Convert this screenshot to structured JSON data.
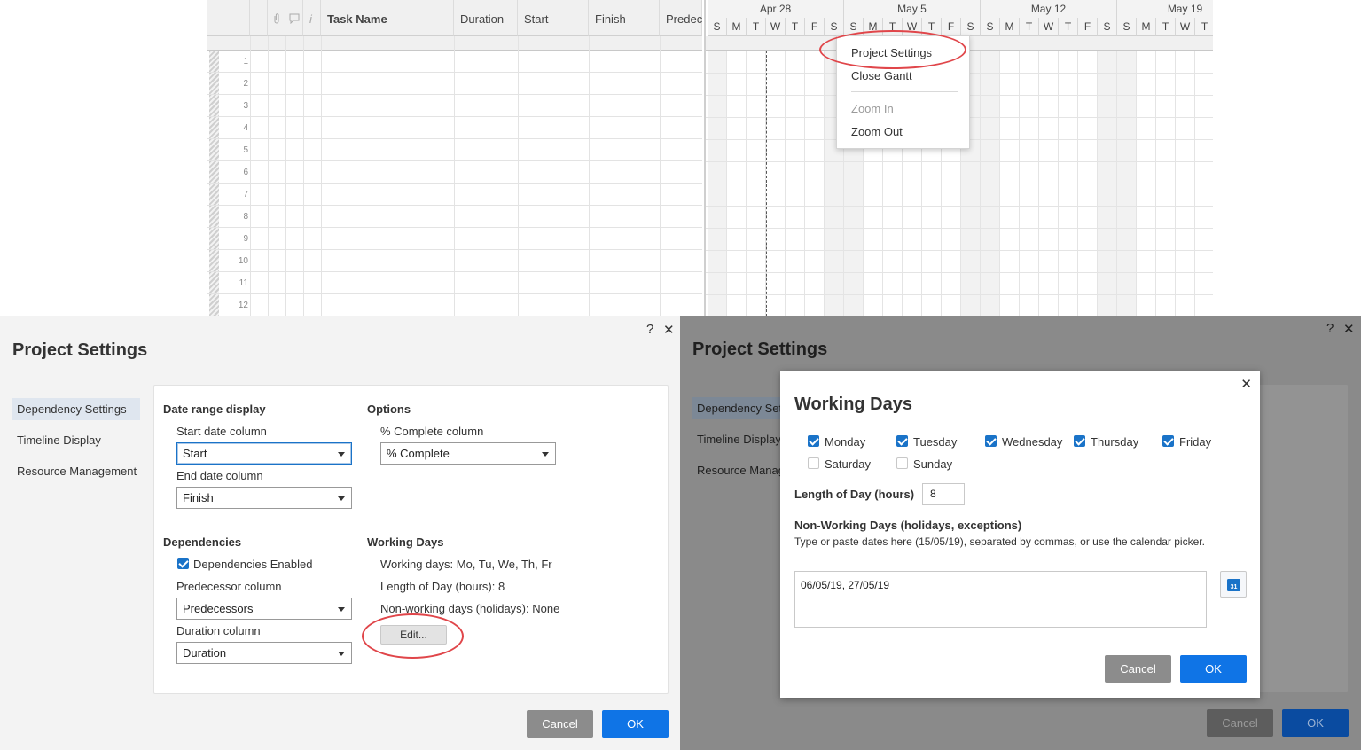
{
  "sheet": {
    "columns": [
      "Task Name",
      "Duration",
      "Start",
      "Finish",
      "Predec"
    ],
    "row_numbers": [
      "1",
      "2",
      "3",
      "4",
      "5",
      "6",
      "7",
      "8",
      "9",
      "10",
      "11",
      "12"
    ]
  },
  "gantt": {
    "weeks": [
      "Apr 28",
      "May 5",
      "May 12",
      "May 19"
    ],
    "days": [
      "S",
      "M",
      "T",
      "W",
      "T",
      "F",
      "S",
      "S",
      "M",
      "T",
      "W",
      "T",
      "F",
      "S",
      "S",
      "M",
      "T",
      "W",
      "T",
      "F",
      "S",
      "S",
      "M",
      "T",
      "W",
      "T"
    ]
  },
  "context_menu": {
    "items": [
      {
        "label": "Project Settings",
        "enabled": true
      },
      {
        "label": "Close Gantt",
        "enabled": true
      },
      {
        "label": "Zoom In",
        "enabled": false
      },
      {
        "label": "Zoom Out",
        "enabled": true
      }
    ]
  },
  "project_settings": {
    "title": "Project Settings",
    "help_icon": "?",
    "close_icon": "✕",
    "nav": [
      "Dependency Settings",
      "Timeline Display",
      "Resource Management"
    ],
    "date_range_display": {
      "heading": "Date range display",
      "start_label": "Start date column",
      "start_value": "Start",
      "end_label": "End date column",
      "end_value": "Finish"
    },
    "options": {
      "heading": "Options",
      "complete_label": "% Complete column",
      "complete_value": "% Complete"
    },
    "dependencies": {
      "heading": "Dependencies",
      "enabled_label": "Dependencies Enabled",
      "enabled": true,
      "predecessor_label": "Predecessor column",
      "predecessor_value": "Predecessors",
      "duration_label": "Duration column",
      "duration_value": "Duration"
    },
    "working_days": {
      "heading": "Working Days",
      "days_line": "Working days: Mo, Tu, We, Th, Fr",
      "length_line": "Length of Day (hours): 8",
      "holidays_line": "Non-working days (holidays): None",
      "edit_label": "Edit..."
    },
    "cancel_label": "Cancel",
    "ok_label": "OK"
  },
  "working_days_modal": {
    "title": "Working Days",
    "close_icon": "✕",
    "days": [
      {
        "label": "Monday",
        "checked": true
      },
      {
        "label": "Tuesday",
        "checked": true
      },
      {
        "label": "Wednesday",
        "checked": true
      },
      {
        "label": "Thursday",
        "checked": true
      },
      {
        "label": "Friday",
        "checked": true
      },
      {
        "label": "Saturday",
        "checked": false
      },
      {
        "label": "Sunday",
        "checked": false
      }
    ],
    "length_label": "Length of Day (hours)",
    "length_value": "8",
    "nonworking_heading": "Non-Working Days (holidays, exceptions)",
    "nonworking_hint": "Type or paste dates here (15/05/19), separated by commas, or use the calendar picker.",
    "nonworking_value": "06/05/19, 27/05/19",
    "calendar_label": "31",
    "cancel_label": "Cancel",
    "ok_label": "OK"
  },
  "colors": {
    "accent": "#0f74e6",
    "highlight_ring": "#e0464a",
    "dim_overlay": "#8a8a8a"
  }
}
